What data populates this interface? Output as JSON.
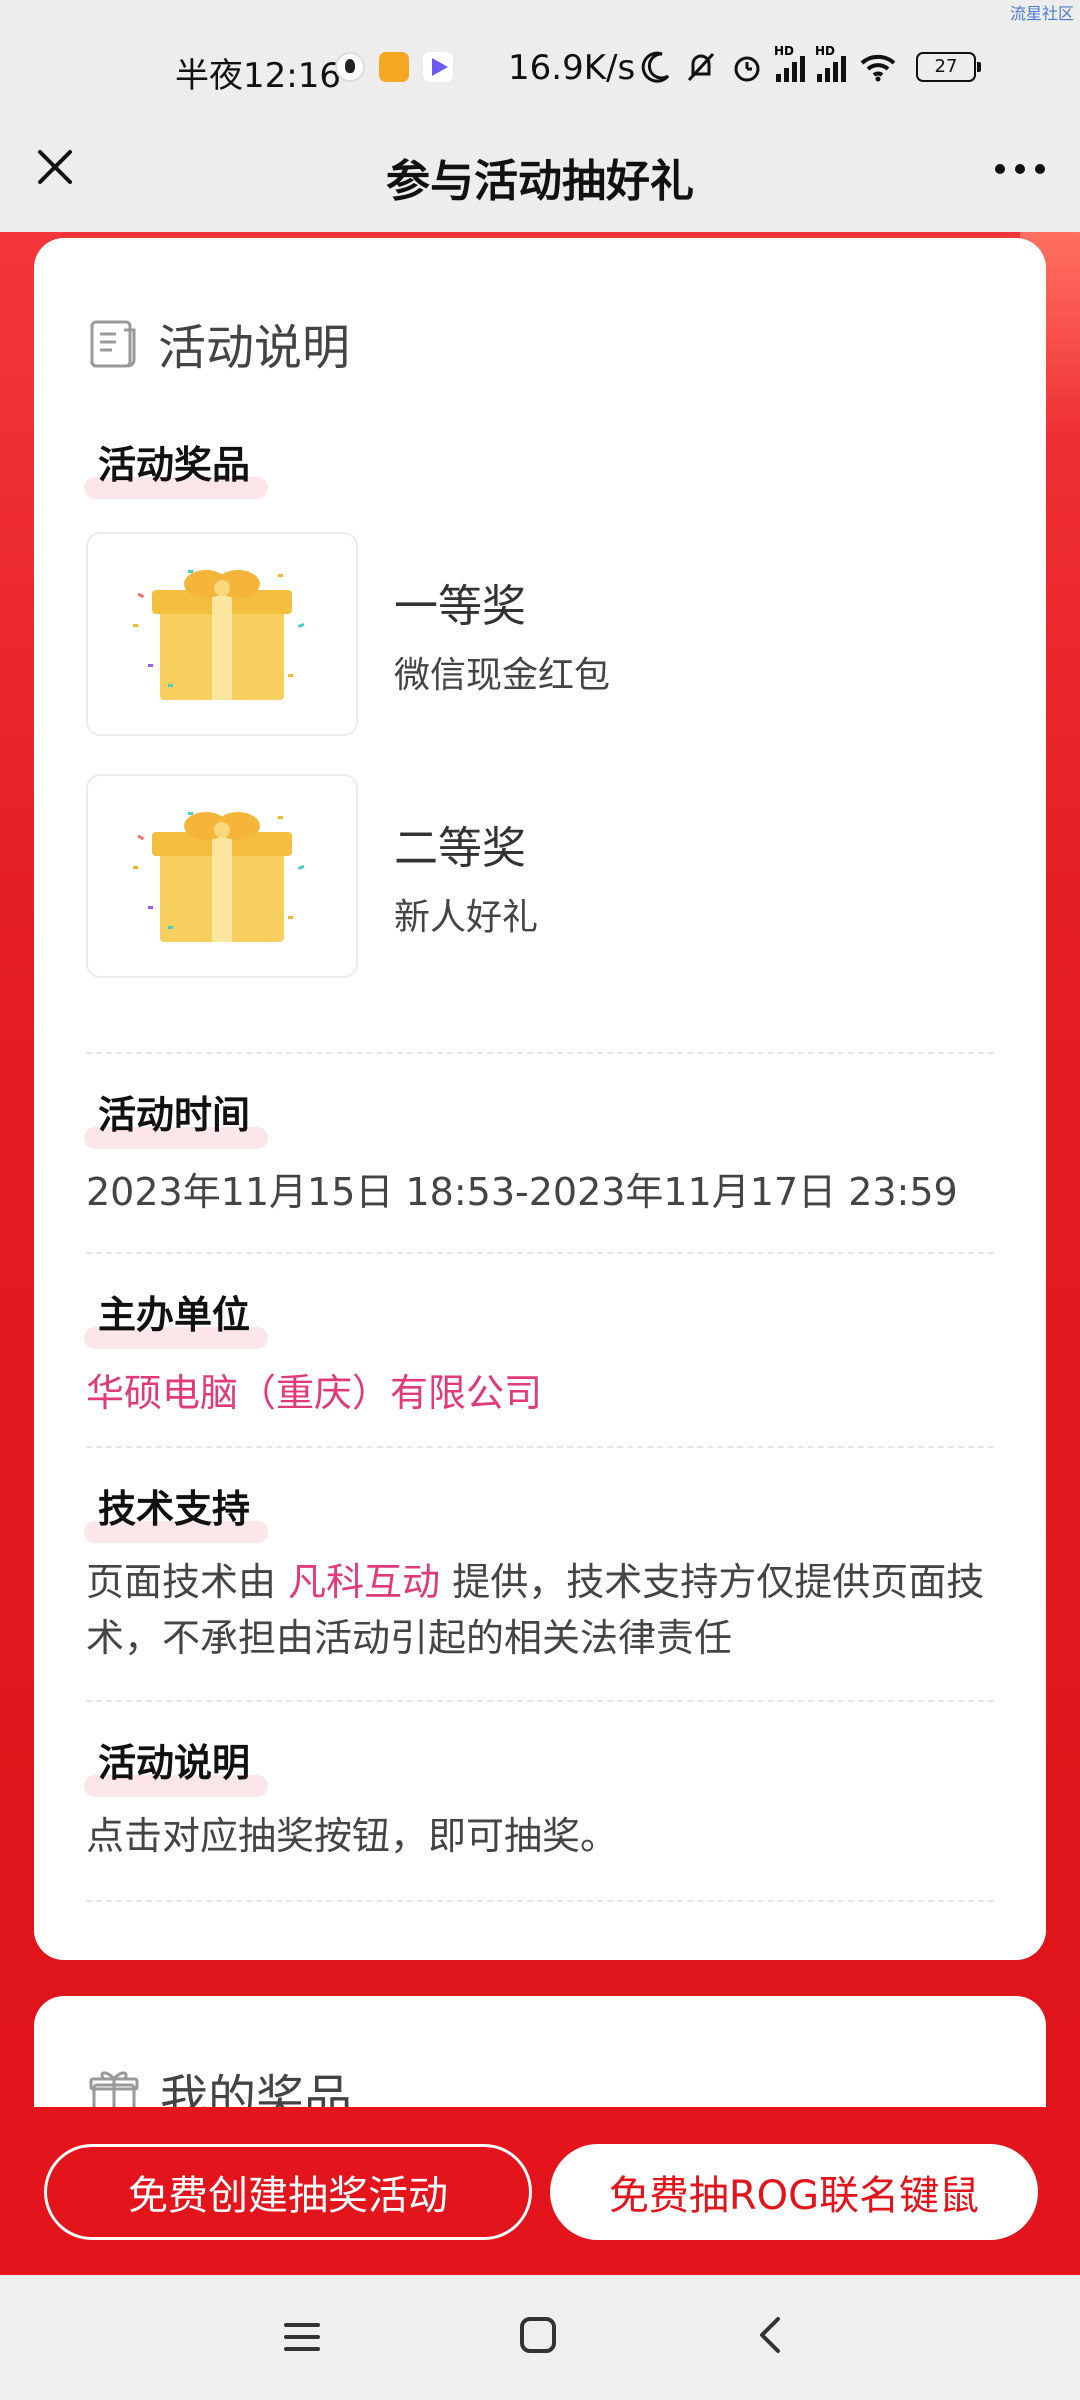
{
  "status_bar": {
    "watermark": "流星社区",
    "time": "半夜12:16",
    "net_speed": "16.9K/s",
    "battery": "27",
    "signal_label_1": "HD",
    "signal_label_2": "HD"
  },
  "nav": {
    "title": "参与活动抽好礼"
  },
  "card": {
    "title": "活动说明",
    "sections": {
      "prizes_label": "活动奖品",
      "time_label": "活动时间",
      "organizer_label": "主办单位",
      "tech_label": "技术支持",
      "desc_label": "活动说明"
    },
    "prizes": [
      {
        "level": "一等奖",
        "name": "微信现金红包"
      },
      {
        "level": "二等奖",
        "name": "新人好礼"
      }
    ],
    "time_value": "2023年11月15日 18:53-2023年11月17日 23:59",
    "organizer": "华硕电脑（重庆）有限公司",
    "tech": {
      "prefix": "页面技术由 ",
      "provider": "凡科互动",
      "suffix": " 提供，技术支持方仅提供页面技术，不承担由活动引起的相关法律责任"
    },
    "description": "点击对应抽奖按钮，即可抽奖。"
  },
  "card2": {
    "title": "我的奖品"
  },
  "bottom": {
    "create_button": "免费创建抽奖活动",
    "draw_button": "免费抽ROG联名键鼠"
  },
  "colors": {
    "primary_red": "#e3141b",
    "pink": "#e03a7a"
  },
  "icons": {
    "close": "close-icon",
    "more": "more-icon",
    "doc": "document-icon",
    "gift": "gift-icon"
  }
}
